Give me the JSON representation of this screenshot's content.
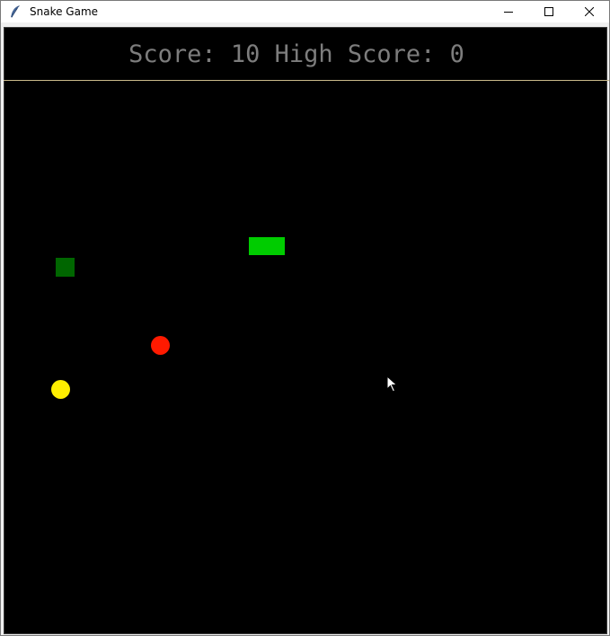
{
  "window": {
    "title": "Snake Game",
    "icon": "feather-icon",
    "controls": [
      "minimize-icon",
      "maximize-icon",
      "close-icon"
    ]
  },
  "game": {
    "score_label": "Score:",
    "score": 10,
    "high_score_label": "High Score:",
    "high_score": 0,
    "score_line": "Score: 10 High Score: 0"
  },
  "colors": {
    "background": "#000000",
    "score_text": "#7d7d7d",
    "divider": "#c9b98a",
    "snake": "#00cc00",
    "obstacle": "#006600",
    "food_red": "#ff1a00",
    "food_yellow": "#ffee00"
  },
  "sprites": {
    "snake": "snake",
    "obstacle": "obstacle-block",
    "food": [
      "food-red",
      "food-yellow"
    ]
  }
}
